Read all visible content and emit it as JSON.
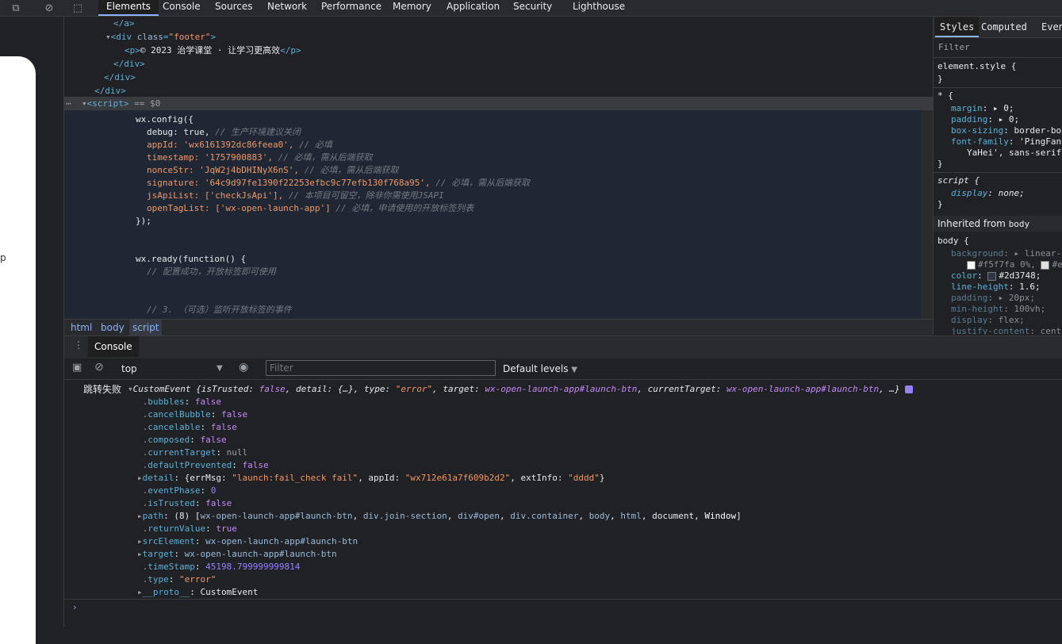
{
  "toolbar": {
    "tabs": [
      "Elements",
      "Console",
      "Sources",
      "Network",
      "Performance",
      "Memory",
      "Application",
      "Security",
      "Lighthouse"
    ]
  },
  "page_preview": {
    "letter": "p"
  },
  "elements": {
    "close_a": "</a>",
    "div_footer_open_tag": "<div",
    "div_footer_attr": "class",
    "div_footer_val": "\"footer\"",
    "p_open": "<p>",
    "p_text": "© 2023 治学课堂 · 让学习更高效",
    "p_close": "</p>",
    "div_close1": "</div>",
    "div_close2": "</div>",
    "div_close3": "</div>",
    "script_open": "<script>",
    "script_eq": "== $0",
    "js": [
      {
        "code": "wx.config({",
        "comment": ""
      },
      {
        "code": "debug: true,",
        "comment": "// 生产环境建议关闭"
      },
      {
        "code": "appId: 'wx6161392dc86feea0',",
        "comment": "// 必填"
      },
      {
        "code": "timestamp: '1757900883',",
        "comment": "// 必填，需从后端获取"
      },
      {
        "code": "nonceStr: 'JqW2j4bDHINyX6nS',",
        "comment": "// 必填，需从后端获取"
      },
      {
        "code": "signature: '64c9d97fe1390f22253efbc9c77efb130f768a95',",
        "comment": "// 必填，需从后端获取"
      },
      {
        "code": "jsApiList: ['checkJsApi'],",
        "comment": "// 本项目可留空，除非你需使用JSAPI"
      },
      {
        "code": "openTagList: ['wx-open-launch-app']",
        "comment": "// 必填，申请使用的开放标签列表"
      },
      {
        "code": "});",
        "comment": ""
      },
      {
        "code": "wx.ready(function() {",
        "comment": ""
      },
      {
        "code": "",
        "comment": "// 配置成功，开放标签即可使用"
      },
      {
        "code": "",
        "comment": "// 3. （可选）监听开放标签的事件"
      }
    ]
  },
  "breadcrumb": [
    "html",
    "body",
    "script"
  ],
  "styles": {
    "tabs": [
      "Styles",
      "Computed",
      "Event"
    ],
    "filter_placeholder": "Filter",
    "element_style": "element.style {",
    "close_brace": "}",
    "universal": "* {",
    "margin_prop": "margin",
    "margin_val": "0;",
    "padding_prop": "padding",
    "padding_val": "0;",
    "boxsizing_prop": "box-sizing",
    "boxsizing_val": "border-box",
    "fontfamily_prop": "font-family",
    "fontfamily_val": "'PingFan",
    "fontfamily_val2": "YaHei', sans-serif",
    "script_sel": "script {",
    "display_prop": "display",
    "display_val": "none;",
    "inherited_label": "Inherited from",
    "inherited_target": "body",
    "body_sel": "body {",
    "background_prop": "background",
    "background_val": "linear-g",
    "bg_stop1": "#f5f7fa 0%,",
    "bg_stop2": "#e",
    "color_prop": "color",
    "color_val": "#2d3748;",
    "lineheight_prop": "line-height",
    "lineheight_val": "1.6;",
    "bpadding_prop": "padding",
    "bpadding_val": "20px;",
    "minheight_prop": "min-height",
    "minheight_val": "100vh;",
    "bdisplay_prop": "display",
    "bdisplay_val": "flex;",
    "justify_prop": "justify-content",
    "justify_val": "cent",
    "colors": {
      "swatch1": "#f5f7fa",
      "swatch2": "#e0e0e0",
      "swatch_color": "#2d3748"
    }
  },
  "drawer": {
    "tab": "Console"
  },
  "console_toolbar": {
    "context": "top",
    "filter_placeholder": "Filter",
    "levels": "Default levels"
  },
  "console": {
    "msg_prefix": "跳转失败",
    "event_summary_a": "CustomEvent {isTrusted: ",
    "event_summary_false": "false",
    "event_summary_b": ", detail: {…}, type: ",
    "event_summary_type": "\"error\"",
    "event_summary_c": ", target: ",
    "event_summary_target": "wx-open-launch-app#launch-btn",
    "event_summary_d": ", currentTarget: ",
    "event_summary_ctarget": "wx-open-launch-app#launch-btn",
    "event_summary_e": ", …}",
    "props": [
      {
        "key": "bubbles",
        "value": "false",
        "kind": "bool",
        "arrow": false
      },
      {
        "key": "cancelBubble",
        "value": "false",
        "kind": "bool",
        "arrow": false
      },
      {
        "key": "cancelable",
        "value": "false",
        "kind": "bool",
        "arrow": false
      },
      {
        "key": "composed",
        "value": "false",
        "kind": "bool",
        "arrow": false
      },
      {
        "key": "currentTarget",
        "value": "null",
        "kind": "null",
        "arrow": false
      },
      {
        "key": "defaultPrevented",
        "value": "false",
        "kind": "bool",
        "arrow": false
      },
      {
        "key": "detail",
        "value": "",
        "kind": "detail",
        "arrow": true
      },
      {
        "key": "eventPhase",
        "value": "0",
        "kind": "num",
        "arrow": false
      },
      {
        "key": "isTrusted",
        "value": "false",
        "kind": "bool",
        "arrow": false
      },
      {
        "key": "path",
        "value": "",
        "kind": "path",
        "arrow": true
      },
      {
        "key": "returnValue",
        "value": "true",
        "kind": "bool",
        "arrow": false
      },
      {
        "key": "srcElement",
        "value": "wx-open-launch-app#launch-btn",
        "kind": "link",
        "arrow": true
      },
      {
        "key": "target",
        "value": "wx-open-launch-app#launch-btn",
        "kind": "link",
        "arrow": true
      },
      {
        "key": "timeStamp",
        "value": "45198.799999999814",
        "kind": "num",
        "arrow": false
      },
      {
        "key": "type",
        "value": "\"error\"",
        "kind": "str",
        "arrow": false
      },
      {
        "key": "__proto__",
        "value": "CustomEvent",
        "kind": "obj",
        "arrow": true
      }
    ],
    "detail": {
      "open": "{errMsg: ",
      "errMsg": "\"launch:fail_check fail\"",
      "mid1": ", appId: ",
      "appId": "\"wx712e61a7f609b2d2\"",
      "mid2": ", extInfo: ",
      "extInfo": "\"dddd\"",
      "close": "}"
    },
    "path": {
      "count": "(8) [",
      "items": [
        "wx-open-launch-app#launch-btn",
        "div.join-section",
        "div#open",
        "div.container",
        "body",
        "html",
        "document",
        "Window"
      ],
      "close": "]"
    }
  }
}
